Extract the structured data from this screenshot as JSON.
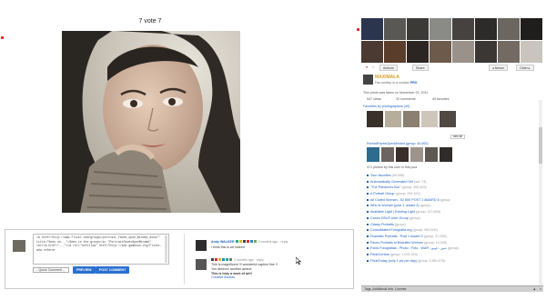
{
  "photo": {
    "title": "7 votе 7"
  },
  "comments": {
    "box_lines": [
      "<a href=\"http://www.flickr.com/groups/portrait_faves_open_minded_dood/\"",
      "title=\"Seen on...\">Seen in the group</a> \"PortraitFavesOpenMinded\"",
      "<br><a href=\"...\"><a rel=\"nofollow\" href=\"http://bdt.gambson.org/Flickr-add-referer",
      ""
    ],
    "select_label": "-- Quick Comment --",
    "preview_button": "PREVIEW",
    "post_button": "POST COMMENT",
    "post1": {
      "author": "Andy WALKER",
      "time": "2 months ago · reply",
      "line1": "I think this is art indeed",
      "line2": "3 hours ago"
    },
    "post2": {
      "time": "2 months ago · reply",
      "line1": "This is magnificent !!! wonderful caption fine !!",
      "line2": "You deserve another award:",
      "line3": "This is truly a work of art!!",
      "link": "Creative Awards"
    }
  },
  "sidebar": {
    "toolbar": {
      "actions": "Actions",
      "share": "Share",
      "newer": "◂ Newer",
      "older": "Older ▸"
    },
    "owner": {
      "name": "MAXIMALA",
      "sub": "Fav-worthy, is a contact",
      "pro": "PRO"
    },
    "stats": {
      "views": "547 views",
      "comments": "32 comments",
      "favorites": "49 favorites"
    },
    "taken": "This photo was taken on November 22, 2011",
    "fav_label": "Favorites by photographers (49)",
    "see_all": "see all",
    "pool_header": "PortraitFavesOpenMinded (group: 40,000)",
    "pool_count": "471 photos by this user in this pool",
    "groups": [
      {
        "name": "Your favorites",
        "meta": "(49,006)"
      },
      {
        "name": "Automatically Generated Set",
        "meta": "(set: 74)"
      },
      {
        "name": "\"The Pandora's box\"",
        "meta": "(group: 409,405)"
      },
      {
        "name": "A Portrait Group",
        "meta": "(group: 299,100)"
      },
      {
        "name": "All Coded Woman - 52 800 POST 1 AWARD 6",
        "meta": "(group:"
      },
      {
        "name": "Who is Woman (post 1, award 2)",
        "meta": "(group)"
      },
      {
        "name": "Available Light | Existing Light",
        "meta": "(group: 117,608)"
      },
      {
        "name": "Canon DSLR User Group",
        "meta": "(group)"
      },
      {
        "name": "Classy Portraits",
        "meta": "(group)"
      },
      {
        "name": "Consolidated Fotografia.org",
        "meta": "(group: 900,000)"
      },
      {
        "name": "Dramatic Portraits - Post 1 Award 3",
        "meta": "(group: 47,000)"
      },
      {
        "name": "Faces Portraits of Beautiful Women",
        "meta": "(group: 10,005)"
      },
      {
        "name": "Fotos Fotografias - Photo - Foto - WAR - صور - فوتو",
        "meta": "(group)"
      },
      {
        "name": "FlickrCentral",
        "meta": "(group: 1,001,003)"
      },
      {
        "name": "FlickrToday (only 1 pic per day)",
        "meta": "(group: 3,651,070)"
      }
    ],
    "bottombar": "Tags, Additional Info, License"
  },
  "colors": {
    "link": "#1b5fbf",
    "button": "#2a6fd1",
    "owner_name": "#d7a02a"
  }
}
